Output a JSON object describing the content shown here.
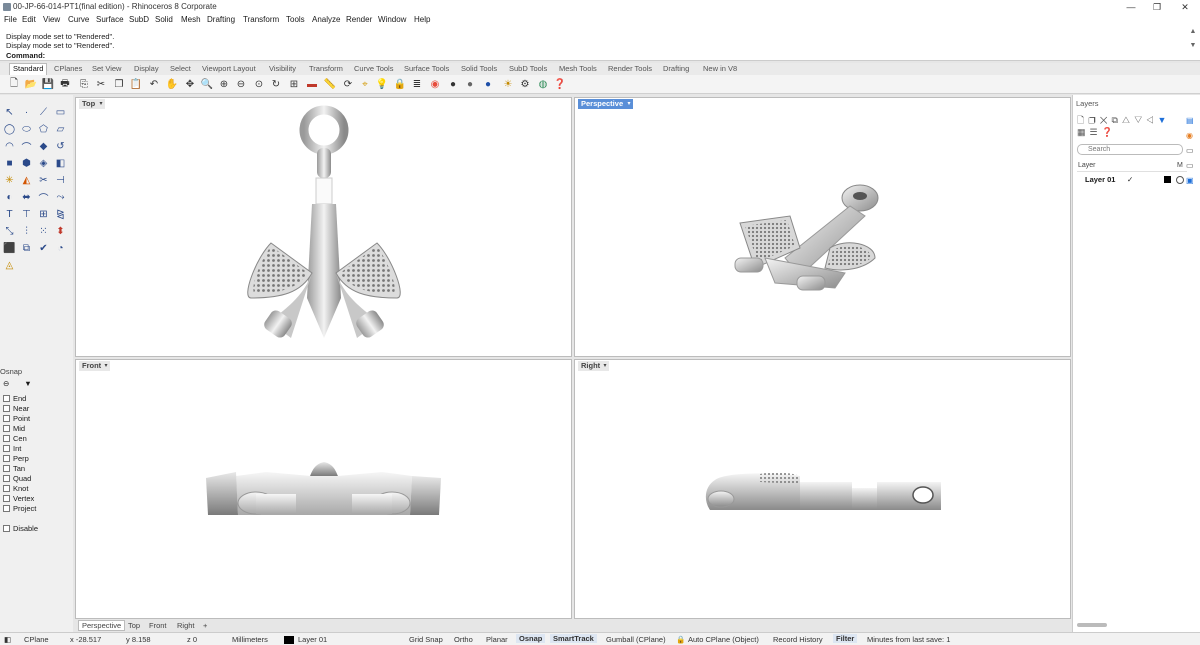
{
  "window": {
    "title": "00-JP-66-014-PT1(final edition) - Rhinoceros 8 Corporate",
    "min": "—",
    "restore": "❐",
    "close": "✕"
  },
  "menu": [
    "File",
    "Edit",
    "View",
    "Curve",
    "Surface",
    "SubD",
    "Solid",
    "Mesh",
    "Drafting",
    "Transform",
    "Tools",
    "Analyze",
    "Render",
    "Window",
    "Help"
  ],
  "command": {
    "history": [
      "Display mode set to \"Rendered\".",
      "Display mode set to \"Rendered\"."
    ],
    "label": "Command:",
    "value": ""
  },
  "toolbar_tabs": [
    "Standard",
    "CPlanes",
    "Set View",
    "Display",
    "Select",
    "Viewport Layout",
    "Visibility",
    "Transform",
    "Curve Tools",
    "Surface Tools",
    "Solid Tools",
    "SubD Tools",
    "Mesh Tools",
    "Render Tools",
    "Drafting",
    "New in V8"
  ],
  "toolbar_icons": [
    "new-file-icon",
    "open-file-icon",
    "save-icon",
    "print-icon",
    "import-icon",
    "cut-icon",
    "copy-icon",
    "paste-icon",
    "undo-icon",
    "pan-icon",
    "move-icon",
    "zoom-icon",
    "zoom-window-icon",
    "zoom-extents-icon",
    "zoom-selected-icon",
    "rotate-view-icon",
    "four-viewports-icon",
    "car-icon",
    "ruler-icon",
    "rotate-icon",
    "cplane-icon",
    "lightbulb-icon",
    "lock-icon",
    "layer-icon",
    "color-wheel-icon",
    "material-sphere-icon",
    "shaded-sphere-icon",
    "rendered-sphere-icon",
    "render-icon",
    "gear-icon",
    "options-icon",
    "help-icon"
  ],
  "osnap": {
    "title": "Osnap",
    "items": [
      "End",
      "Near",
      "Point",
      "Mid",
      "Cen",
      "Int",
      "Perp",
      "Tan",
      "Quad",
      "Knot",
      "Vertex",
      "Project"
    ],
    "disable": "Disable"
  },
  "viewports": {
    "top": "Top",
    "perspective": "Perspective",
    "front": "Front",
    "right": "Right"
  },
  "viewport_tabs": [
    "Perspective",
    "Top",
    "Front",
    "Right"
  ],
  "viewport_tab_add": "+",
  "layers": {
    "title": "Layers",
    "search_placeholder": "Search",
    "col_layer": "Layer",
    "col_m": "M",
    "layer_name": "Layer 01",
    "current_mark": "✓",
    "layer_color": "#000000"
  },
  "status": {
    "cplane": "CPlane",
    "x": "x -28.517",
    "y": "y 8.158",
    "z": "z 0",
    "units": "Millimeters",
    "layer": "Layer 01",
    "grid_snap": "Grid Snap",
    "ortho": "Ortho",
    "planar": "Planar",
    "osnap": "Osnap",
    "smarttrack": "SmartTrack",
    "gumball": "Gumball (CPlane)",
    "auto_cplane": "Auto CPlane (Object)",
    "record_history": "Record History",
    "filter": "Filter",
    "last_save": "Minutes from last save: 1"
  },
  "colors": {
    "active_viewport": "#5a8fd8",
    "model": "#c8c8c8"
  }
}
